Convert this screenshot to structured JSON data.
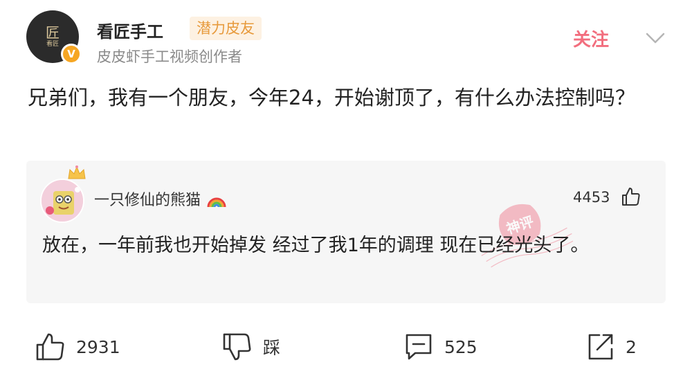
{
  "author": {
    "avatar_mark": "匠",
    "avatar_sub": "看匠",
    "name": "看匠手工",
    "tag": "潜力皮友",
    "description": "皮皮虾手工视频创作者",
    "follow_label": "关注",
    "verified_badge": "V",
    "icons": {
      "verified": "v-badge-icon",
      "dropdown": "chevron-down-icon"
    }
  },
  "post": {
    "text": "兄弟们，我有一个朋友，今年24，开始谢顶了，有什么办法控制吗？"
  },
  "comment": {
    "username": "一只修仙的熊猫",
    "username_emoji": "rainbow-icon",
    "likes": "4453",
    "text": "放在，一年前我也开始掉发  经过了我1年的调理  现在已经光头了。",
    "stamp_text": "神评",
    "icons": {
      "like": "thumbs-up-icon",
      "crown": "crown-icon",
      "stamp": "god-comment-stamp-icon"
    }
  },
  "actions": {
    "like_count": "2931",
    "dislike_label": "踩",
    "comment_count": "525",
    "share_count": "2",
    "icons": {
      "like": "thumbs-up-icon",
      "dislike": "thumbs-down-icon",
      "comment": "comment-icon",
      "share": "share-icon"
    }
  },
  "colors": {
    "follow": "#f26e7e",
    "tag_text": "#e79a3c",
    "tag_bg": "#fdf1e2",
    "badge": "#f6a623",
    "card_bg": "#f6f6f6",
    "stamp": "#f08a9a"
  }
}
